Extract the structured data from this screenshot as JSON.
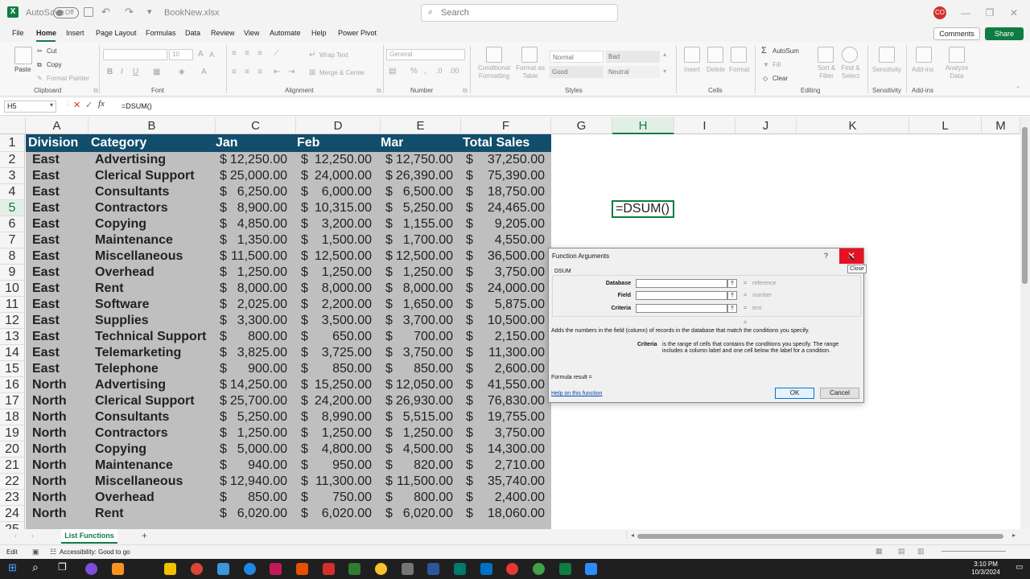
{
  "title_bar": {
    "autosave_label": "AutoSave",
    "autosave_state": "Off",
    "file_name": "BookNew.xlsx",
    "search_placeholder": "Search",
    "profile_initials": "CO"
  },
  "menu": {
    "tabs": [
      "File",
      "Home",
      "Insert",
      "Page Layout",
      "Formulas",
      "Data",
      "Review",
      "View",
      "Automate",
      "Help",
      "Power Pivot"
    ],
    "comments_label": "Comments",
    "share_label": "Share"
  },
  "ribbon": {
    "clipboard": {
      "paste": "Paste",
      "cut": "Cut",
      "copy": "Copy",
      "format_painter": "Format Painter",
      "label": "Clipboard"
    },
    "font": {
      "size": "10",
      "label": "Font"
    },
    "alignment": {
      "wrap": "Wrap Text",
      "merge": "Merge & Center",
      "label": "Alignment"
    },
    "number": {
      "format": "General",
      "label": "Number"
    },
    "styles": {
      "conditional": "Conditional Formatting",
      "format_table": "Format as Table",
      "normal": "Normal",
      "bad": "Bad",
      "good": "Good",
      "neutral": "Neutral",
      "label": "Styles"
    },
    "cells": {
      "insert": "Insert",
      "delete": "Delete",
      "format": "Format",
      "label": "Cells"
    },
    "editing": {
      "autosum": "AutoSum",
      "fill": "Fill",
      "clear": "Clear",
      "sort": "Sort & Filter",
      "find": "Find & Select",
      "label": "Editing"
    },
    "sensitivity": {
      "button": "Sensitivity",
      "label": "Sensitivity"
    },
    "addins": {
      "button": "Add-ins",
      "analyze": "Analyze Data",
      "label": "Add-ins"
    }
  },
  "formula_bar": {
    "name_box": "H5",
    "formula": "=DSUM()"
  },
  "columns": [
    "A",
    "B",
    "C",
    "D",
    "E",
    "F",
    "G",
    "H",
    "I",
    "J",
    "K",
    "L",
    "M"
  ],
  "table": {
    "headers": [
      "Division",
      "Category",
      "Jan",
      "Feb",
      "Mar",
      "Total Sales"
    ],
    "rows": [
      [
        "East",
        "Advertising",
        "12,250.00",
        "12,250.00",
        "12,750.00",
        "37,250.00"
      ],
      [
        "East",
        "Clerical Support",
        "25,000.00",
        "24,000.00",
        "26,390.00",
        "75,390.00"
      ],
      [
        "East",
        "Consultants",
        "6,250.00",
        "6,000.00",
        "6,500.00",
        "18,750.00"
      ],
      [
        "East",
        "Contractors",
        "8,900.00",
        "10,315.00",
        "5,250.00",
        "24,465.00"
      ],
      [
        "East",
        "Copying",
        "4,850.00",
        "3,200.00",
        "1,155.00",
        "9,205.00"
      ],
      [
        "East",
        "Maintenance",
        "1,350.00",
        "1,500.00",
        "1,700.00",
        "4,550.00"
      ],
      [
        "East",
        "Miscellaneous",
        "11,500.00",
        "12,500.00",
        "12,500.00",
        "36,500.00"
      ],
      [
        "East",
        "Overhead",
        "1,250.00",
        "1,250.00",
        "1,250.00",
        "3,750.00"
      ],
      [
        "East",
        "Rent",
        "8,000.00",
        "8,000.00",
        "8,000.00",
        "24,000.00"
      ],
      [
        "East",
        "Software",
        "2,025.00",
        "2,200.00",
        "1,650.00",
        "5,875.00"
      ],
      [
        "East",
        "Supplies",
        "3,300.00",
        "3,500.00",
        "3,700.00",
        "10,500.00"
      ],
      [
        "East",
        "Technical Support",
        "800.00",
        "650.00",
        "700.00",
        "2,150.00"
      ],
      [
        "East",
        "Telemarketing",
        "3,825.00",
        "3,725.00",
        "3,750.00",
        "11,300.00"
      ],
      [
        "East",
        "Telephone",
        "900.00",
        "850.00",
        "850.00",
        "2,600.00"
      ],
      [
        "North",
        "Advertising",
        "14,250.00",
        "15,250.00",
        "12,050.00",
        "41,550.00"
      ],
      [
        "North",
        "Clerical Support",
        "25,700.00",
        "24,200.00",
        "26,930.00",
        "76,830.00"
      ],
      [
        "North",
        "Consultants",
        "5,250.00",
        "8,990.00",
        "5,515.00",
        "19,755.00"
      ],
      [
        "North",
        "Contractors",
        "1,250.00",
        "1,250.00",
        "1,250.00",
        "3,750.00"
      ],
      [
        "North",
        "Copying",
        "5,000.00",
        "4,800.00",
        "4,500.00",
        "14,300.00"
      ],
      [
        "North",
        "Maintenance",
        "940.00",
        "950.00",
        "820.00",
        "2,710.00"
      ],
      [
        "North",
        "Miscellaneous",
        "12,940.00",
        "11,300.00",
        "11,500.00",
        "35,740.00"
      ],
      [
        "North",
        "Overhead",
        "850.00",
        "750.00",
        "800.00",
        "2,400.00"
      ],
      [
        "North",
        "Rent",
        "6,020.00",
        "6,020.00",
        "6,020.00",
        "18,060.00"
      ]
    ],
    "currency": "$"
  },
  "active_cell": {
    "content": "=DSUM()"
  },
  "dialog": {
    "title": "Function Arguments",
    "help_glyph": "?",
    "close_tooltip": "Close",
    "function_name": "DSUM",
    "args": [
      {
        "label": "Database",
        "hint": "reference"
      },
      {
        "label": "Field",
        "hint": "number"
      },
      {
        "label": "Criteria",
        "hint": "text"
      }
    ],
    "equals": "=",
    "description": "Adds the numbers in the field (column) of records in the database that match the conditions you specify.",
    "arg_name": "Criteria",
    "arg_description": "is the range of cells that contains the conditions you specify. The range includes a column label and one cell below the label for a condition.",
    "formula_result": "Formula result =",
    "help_link": "Help on this function",
    "ok": "OK",
    "cancel": "Cancel"
  },
  "sheet": {
    "tab": "List Functions",
    "add": "+"
  },
  "status": {
    "mode": "Edit",
    "accessibility": "Accessibility: Good to go"
  },
  "clock": {
    "time": "3:10 PM",
    "date": "10/3/2024"
  },
  "colors": {
    "excel_green": "#107c41",
    "header_fill": "#124e6b",
    "data_fill": "#bfbfbf",
    "close_red": "#e81123"
  }
}
